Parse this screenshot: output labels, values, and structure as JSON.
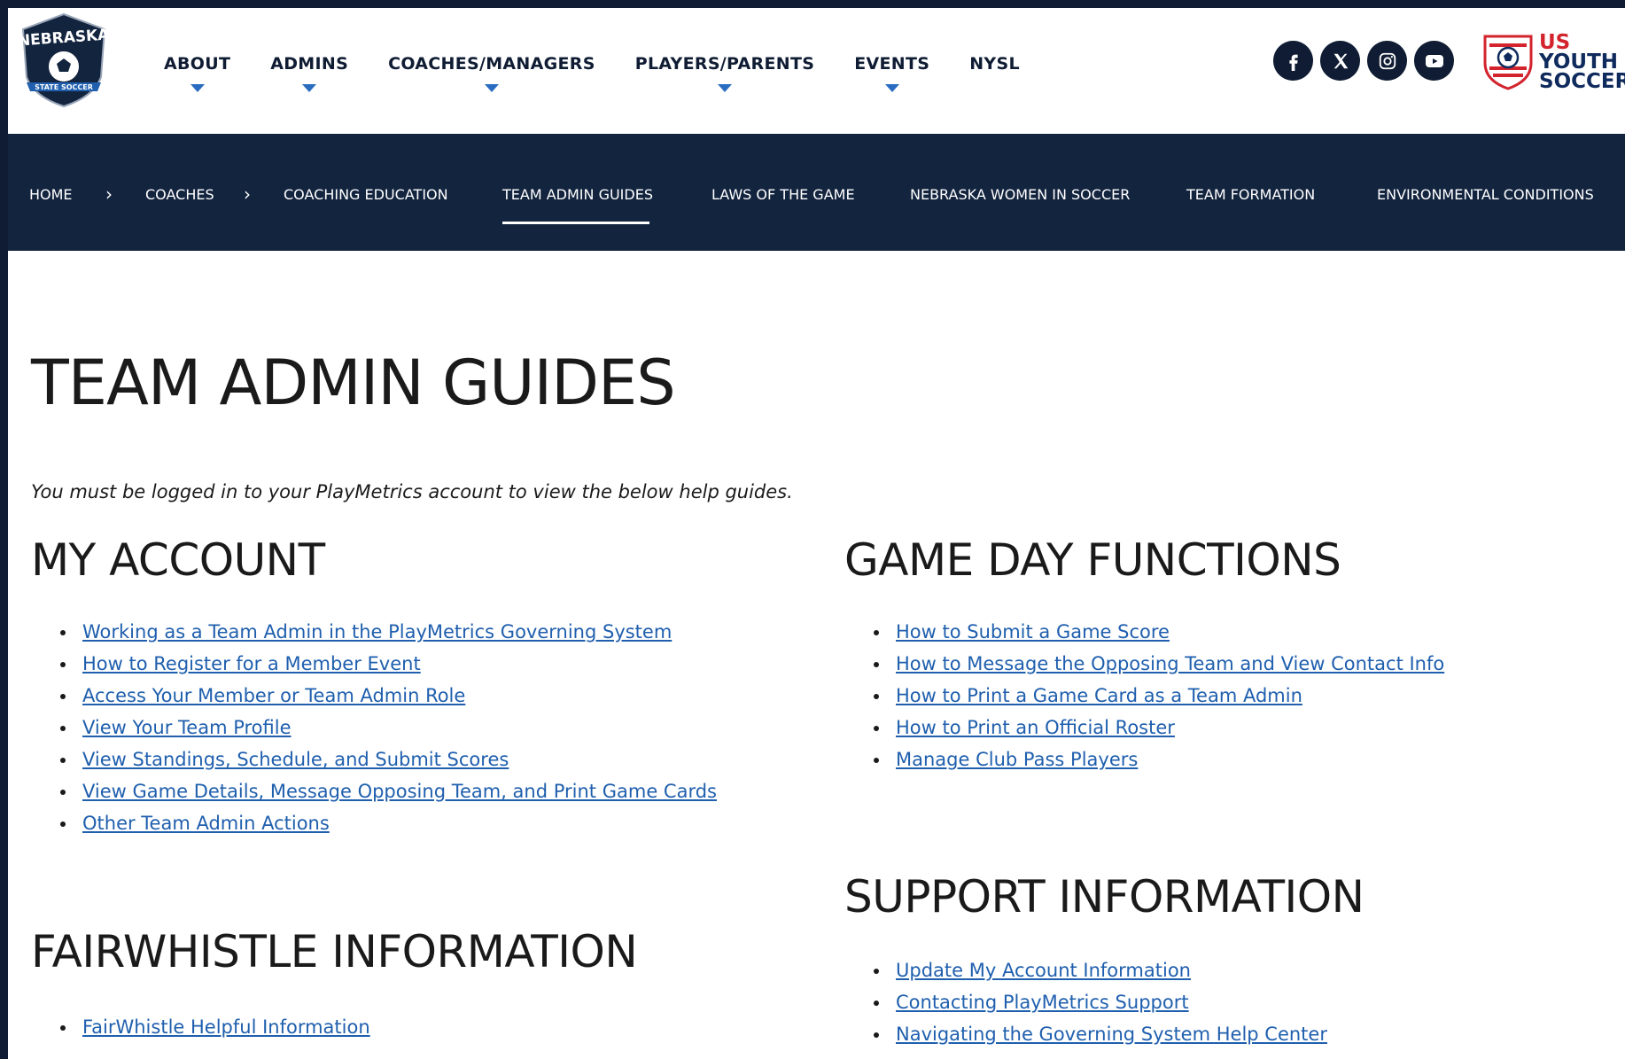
{
  "header": {
    "logo_text": "NEBRASKA STATE SOCCER",
    "nav": [
      {
        "label": "ABOUT",
        "has_dropdown": true
      },
      {
        "label": "ADMINS",
        "has_dropdown": true
      },
      {
        "label": "COACHES/MANAGERS",
        "has_dropdown": true
      },
      {
        "label": "PLAYERS/PARENTS",
        "has_dropdown": true
      },
      {
        "label": "EVENTS",
        "has_dropdown": true
      },
      {
        "label": "NYSL",
        "has_dropdown": false
      }
    ],
    "social_icons": [
      "facebook-icon",
      "x-icon",
      "instagram-icon",
      "youtube-icon"
    ],
    "partner_logo": {
      "line1": "US",
      "line2": "YOUTH",
      "line3": "SOCCER"
    }
  },
  "subnav": {
    "breadcrumb": [
      "HOME",
      "COACHES",
      "COACHING EDUCATION"
    ],
    "separator": "›",
    "tabs": [
      "TEAM ADMIN GUIDES",
      "LAWS OF THE GAME",
      "NEBRASKA WOMEN IN SOCCER",
      "TEAM FORMATION",
      "ENVIRONMENTAL CONDITIONS"
    ],
    "active_tab": "TEAM ADMIN GUIDES"
  },
  "page": {
    "title": "TEAM ADMIN GUIDES",
    "notice": "You must be logged in to your PlayMetrics account to view the below help guides."
  },
  "sections": {
    "my_account": {
      "title": "MY ACCOUNT",
      "links": [
        "Working as a Team Admin in the PlayMetrics Governing System",
        "How to Register for a Member Event",
        "Access Your Member or Team Admin Role",
        "View Your Team Profile",
        "View Standings, Schedule, and Submit Scores",
        "View Game Details, Message Opposing Team, and Print Game Cards",
        "Other Team Admin Actions"
      ]
    },
    "game_day": {
      "title": "GAME DAY FUNCTIONS",
      "links": [
        "How to Submit a Game Score",
        "How to Message the Opposing Team and View Contact Info",
        "How to Print a Game Card as a Team Admin",
        "How to Print an Official Roster",
        "Manage Club Pass Players"
      ]
    },
    "support": {
      "title": "SUPPORT INFORMATION",
      "links": [
        "Update My Account Information",
        "Contacting PlayMetrics Support",
        "Navigating the Governing System Help Center"
      ]
    },
    "fairwhistle": {
      "title": "FAIRWHISTLE INFORMATION",
      "links": [
        "FairWhistle Helpful Information"
      ]
    }
  },
  "colors": {
    "navy": "#13243f",
    "link": "#1f5fae",
    "caret": "#2a6cc0",
    "red": "#d3242e"
  }
}
